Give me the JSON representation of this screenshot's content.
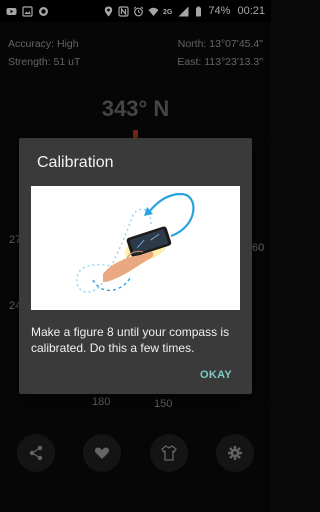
{
  "status_bar": {
    "battery": "74%",
    "time": "00:21",
    "icons": [
      "youtube-icon",
      "gallery-icon",
      "circle-app-icon",
      "location-icon",
      "nfc-icon",
      "alarm-icon",
      "wifi-icon",
      "2g-icon",
      "signal-icon",
      "battery-icon"
    ]
  },
  "compass": {
    "accuracy": "Accuracy: High",
    "strength": "Strength: 51 uT",
    "north": "North: 13°07'45.4\"",
    "east": "East: 113°23'13.3\"",
    "heading": "343° N",
    "dial_labels": [
      "27",
      "24",
      "180",
      "150",
      "60"
    ]
  },
  "dialog": {
    "title": "Calibration",
    "message": "Make a figure 8 until your compass is calibrated. Do this a few times.",
    "ok_label": "OKAY"
  },
  "bottom_bar": {
    "buttons": [
      "share-icon",
      "heart-icon",
      "shirt-icon",
      "gear-icon"
    ]
  },
  "colors": {
    "accent": "#80cbc4",
    "dialog_bg": "#3a3a3a",
    "background": "#0a0a0a",
    "needle": "#c0392b"
  }
}
